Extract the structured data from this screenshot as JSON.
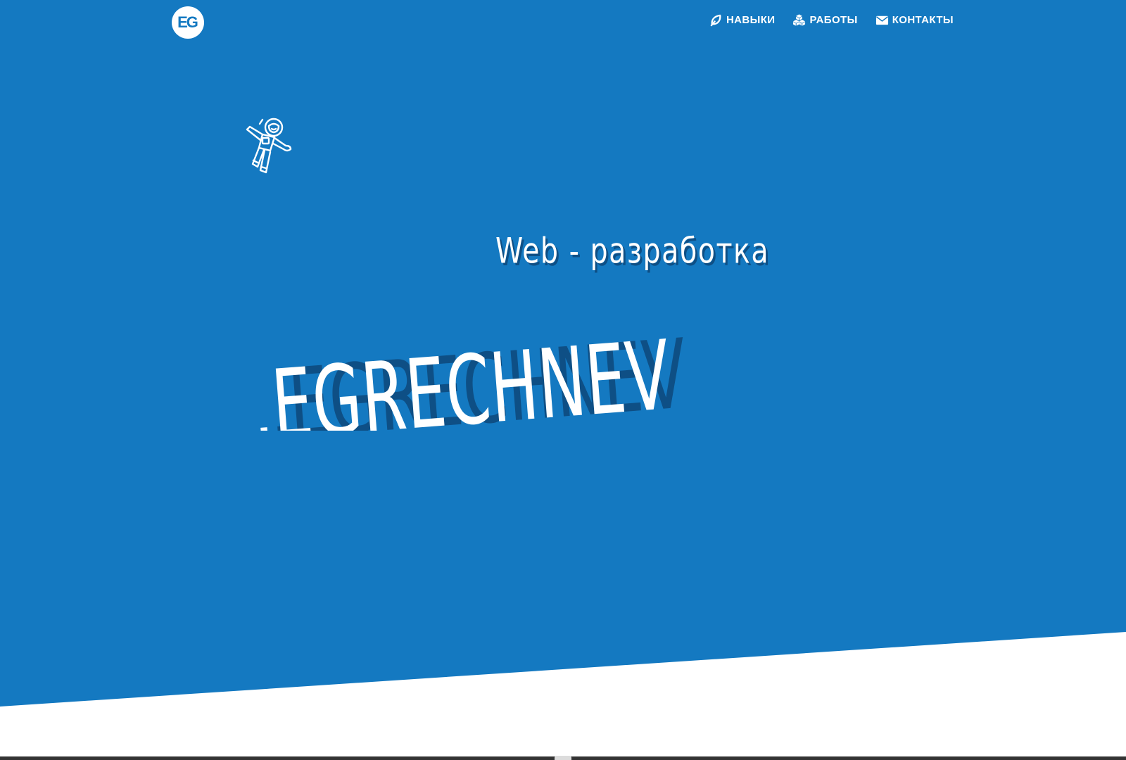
{
  "colors": {
    "hero_background": "#1479c1",
    "text": "#ffffff",
    "text_shadow": "#0e4f85",
    "section_background": "#ffffff"
  },
  "header": {
    "logo_text": "EG",
    "nav": [
      {
        "label": "НАВЫКИ",
        "icon": "leaf-icon"
      },
      {
        "label": "РАБОТЫ",
        "icon": "cubes-icon"
      },
      {
        "label": "КОНТАКТЫ",
        "icon": "envelope-icon"
      }
    ]
  },
  "hero": {
    "illustration": "astronaut-icon",
    "subtitle": "Web - разработка",
    "brand_name": ".EGRECHNEV"
  }
}
